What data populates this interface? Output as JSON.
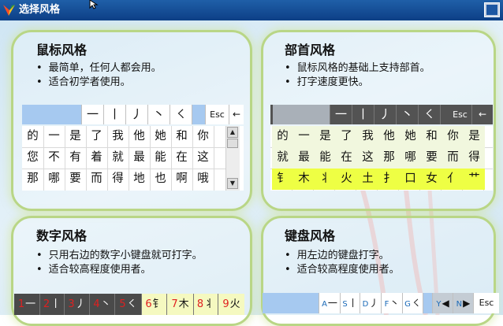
{
  "window": {
    "title": "选择风格",
    "accent": "#0d3f86"
  },
  "panels": {
    "mouse": {
      "title": "鼠标风格",
      "bullets": [
        "最简单，任何人都会用。",
        "适合初学者使用。"
      ]
    },
    "radical": {
      "title": "部首风格",
      "bullets": [
        "鼠标风格的基础上支持部首。",
        "打字速度更快。"
      ]
    },
    "number": {
      "title": "数字风格",
      "bullets": [
        "只用右边的数字小键盘就可打字。",
        "适合较高程度使用者。"
      ]
    },
    "keyboard": {
      "title": "键盘风格",
      "bullets": [
        "用左边的键盘打字。",
        "适合较高程度使用者。"
      ]
    }
  },
  "strokes": [
    "一",
    "丨",
    "丿",
    "丶",
    "㇛"
  ],
  "esc_label": "Esc",
  "arrow_label": "←",
  "mouse_grid": [
    [
      "的",
      "一",
      "是",
      "了",
      "我",
      "他",
      "她",
      "和",
      "你"
    ],
    [
      "您",
      "不",
      "有",
      "着",
      "就",
      "最",
      "能",
      "在",
      "这"
    ],
    [
      "那",
      "哪",
      "要",
      "而",
      "得",
      "地",
      "也",
      "啊",
      "哦"
    ]
  ],
  "radical_grid": [
    [
      "的",
      "一",
      "是",
      "了",
      "我",
      "他",
      "她",
      "和",
      "你",
      "是"
    ],
    [
      "就",
      "最",
      "能",
      "在",
      "这",
      "那",
      "哪",
      "要",
      "而",
      "得"
    ],
    [
      "钅",
      "木",
      "丬",
      "火",
      "土",
      "扌",
      "口",
      "女",
      "亻",
      "艹"
    ]
  ],
  "number_keys": [
    {
      "n": "1",
      "t": "一"
    },
    {
      "n": "2",
      "t": "丨"
    },
    {
      "n": "3",
      "t": "丿"
    },
    {
      "n": "4",
      "t": "丶"
    },
    {
      "n": "5",
      "t": "㇛"
    },
    {
      "n": "6",
      "t": "钅"
    },
    {
      "n": "7",
      "t": "木"
    },
    {
      "n": "8",
      "t": "丬"
    },
    {
      "n": "9",
      "t": "火"
    }
  ],
  "keyboard_keys": [
    {
      "k": "A",
      "t": "一"
    },
    {
      "k": "S",
      "t": "丨"
    },
    {
      "k": "D",
      "t": "丿"
    },
    {
      "k": "F",
      "t": "丶"
    },
    {
      "k": "G",
      "t": "㇛"
    },
    {
      "k": "Y",
      "t": "◀"
    },
    {
      "k": "N",
      "t": "▶"
    }
  ]
}
